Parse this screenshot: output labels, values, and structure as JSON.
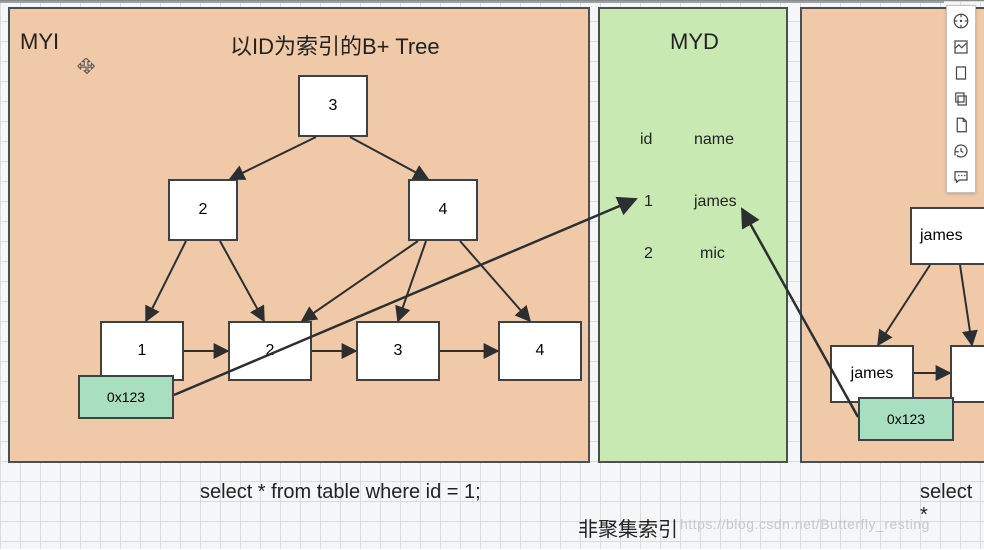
{
  "panels": {
    "myi": {
      "title": "MYI",
      "tree_title": "以ID为索引的B+ Tree"
    },
    "myd": {
      "title": "MYD"
    }
  },
  "tree": {
    "root": "3",
    "level2": [
      "2",
      "4"
    ],
    "leaves": [
      "1",
      "2",
      "3",
      "4"
    ],
    "address_tag": "0x123"
  },
  "myd_table": {
    "headers": {
      "id": "id",
      "name": "name"
    },
    "rows": [
      {
        "id": "1",
        "name": "james"
      },
      {
        "id": "2",
        "name": "mic"
      }
    ]
  },
  "right_panel": {
    "leaf1": "james",
    "leaf2": "james",
    "address_tag": "0x123"
  },
  "queries": {
    "q1": "select * from table where id = 1;",
    "q2": "select *"
  },
  "caption": "非聚集索引",
  "watermark": "https://blog.csdn.net/Butterfly_resting",
  "toolbar": {
    "items": [
      {
        "name": "compass-icon"
      },
      {
        "name": "full-extent-icon"
      },
      {
        "name": "snap-icon"
      },
      {
        "name": "copy-icon"
      },
      {
        "name": "new-page-icon"
      },
      {
        "name": "history-icon"
      },
      {
        "name": "comment-icon"
      }
    ]
  }
}
